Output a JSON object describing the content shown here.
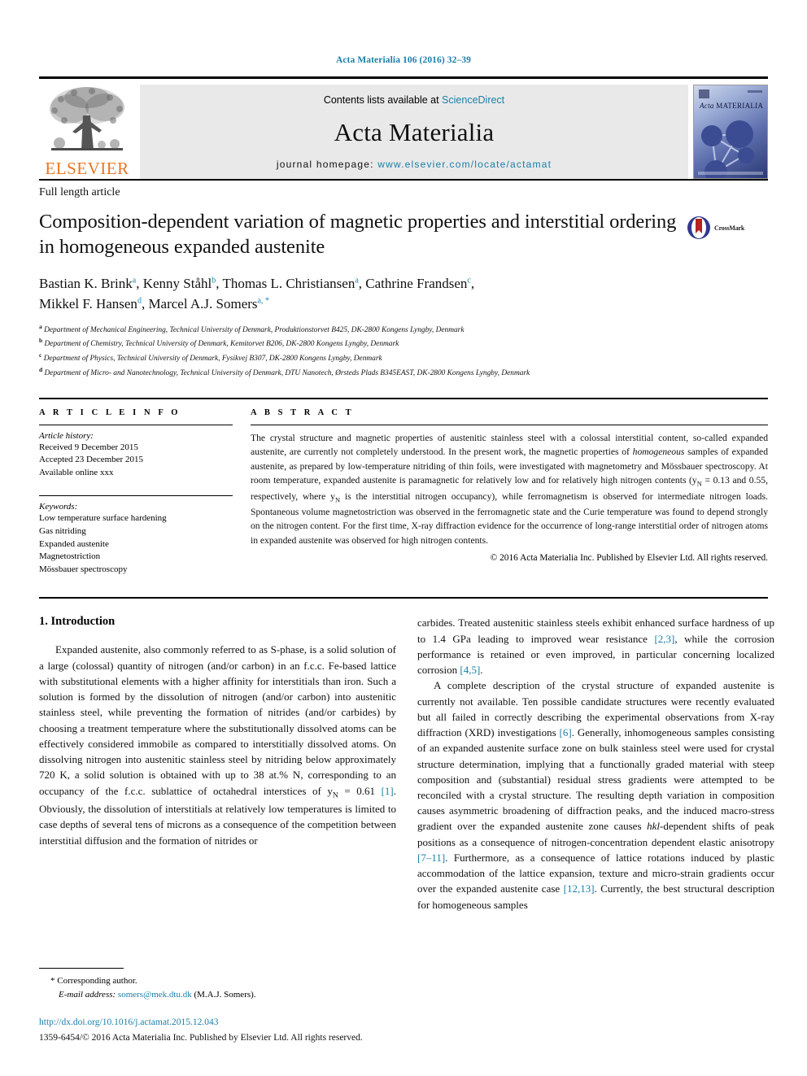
{
  "running_head": "Acta Materialia 106 (2016) 32–39",
  "masthead": {
    "publisher_logo_text": "ELSEVIER",
    "contents_prefix": "Contents lists available at ",
    "contents_link": "ScienceDirect",
    "journal_name": "Acta Materialia",
    "homepage_prefix": "journal homepage: ",
    "homepage_url": "www.elsevier.com/locate/actamat",
    "cover_title_italic": "Acta",
    "cover_title_rest": "MATERIALIA"
  },
  "article": {
    "type": "Full length article",
    "title": "Composition-dependent variation of magnetic properties and interstitial ordering in homogeneous expanded austenite",
    "crossmark_label": "CrossMark"
  },
  "authors": [
    {
      "name": "Bastian K. Brink",
      "sup": "a"
    },
    {
      "name": "Kenny Ståhl",
      "sup": "b"
    },
    {
      "name": "Thomas L. Christiansen",
      "sup": "a"
    },
    {
      "name": "Cathrine Frandsen",
      "sup": "c"
    },
    {
      "name": "Mikkel F. Hansen",
      "sup": "d"
    },
    {
      "name": "Marcel A.J. Somers",
      "sup": "a, *"
    }
  ],
  "affiliations": [
    {
      "mark": "a",
      "text": "Department of Mechanical Engineering, Technical University of Denmark, Produktionstorvet B425, DK-2800 Kongens Lyngby, Denmark"
    },
    {
      "mark": "b",
      "text": "Department of Chemistry, Technical University of Denmark, Kemitorvet B206, DK-2800 Kongens Lyngby, Denmark"
    },
    {
      "mark": "c",
      "text": "Department of Physics, Technical University of Denmark, Fysikvej B307, DK-2800 Kongens Lyngby, Denmark"
    },
    {
      "mark": "d",
      "text": "Department of Micro- and Nanotechnology, Technical University of Denmark, DTU Nanotech, Ørsteds Plads B345EAST, DK-2800 Kongens Lyngby, Denmark"
    }
  ],
  "article_info": {
    "heading": "A R T I C L E   I N F O",
    "history_label": "Article history:",
    "history": [
      "Received 9 December 2015",
      "Accepted 23 December 2015",
      "Available online xxx"
    ],
    "keywords_label": "Keywords:",
    "keywords": [
      "Low temperature surface hardening",
      "Gas nitriding",
      "Expanded austenite",
      "Magnetostriction",
      "Mössbauer spectroscopy"
    ]
  },
  "abstract": {
    "heading": "A B S T R A C T",
    "paragraph_1": "The crystal structure and magnetic properties of austenitic stainless steel with a colossal interstitial content, so-called expanded austenite, are currently not completely understood. In the present work, the magnetic properties of ",
    "emphasis_1": "homogeneous",
    "paragraph_2": " samples of expanded austenite, as prepared by low-temperature nitriding of thin foils, were investigated with magnetometry and Mössbauer spectroscopy. At room temperature, expanded austenite is paramagnetic for relatively low and for relatively high nitrogen contents (y",
    "sub_1": "N",
    "paragraph_3": " = 0.13 and 0.55, respectively, where y",
    "sub_2": "N",
    "paragraph_4": " is the interstitial nitrogen occupancy), while ferromagnetism is observed for intermediate nitrogen loads. Spontaneous volume magnetostriction was observed in the ferromagnetic state and the Curie temperature was found to depend strongly on the nitrogen content. For the first time, X-ray diffraction evidence for the occurrence of long-range interstitial order of nitrogen atoms in expanded austenite was observed for high nitrogen contents.",
    "copyright": "© 2016 Acta Materialia Inc. Published by Elsevier Ltd. All rights reserved."
  },
  "introduction": {
    "heading": "1. Introduction",
    "left_p1_a": "Expanded austenite, also commonly referred to as S-phase, is a solid solution of a large (colossal) quantity of nitrogen (and/or carbon) in an f.c.c. Fe-based lattice with substitutional elements with a higher affinity for interstitials than iron. Such a solution is formed by the dissolution of nitrogen (and/or carbon) into austenitic stainless steel, while preventing the formation of nitrides (and/or carbides) by choosing a treatment temperature where the substitutionally dissolved atoms can be effectively considered immobile as compared to interstitially dissolved atoms. On dissolving nitrogen into austenitic stainless steel by nitriding below approximately 720 K, a solid solution is obtained with up to 38 at.% N, corresponding to an occupancy of the f.c.c. sublattice of octahedral interstices of y",
    "left_sub": "N",
    "left_p1_b": " = 0.61 ",
    "left_ref1": "[1]",
    "left_p1_c": ". Obviously, the dissolution of interstitials at relatively low temperatures is limited to case depths of several tens of microns as a consequence of the competition between interstitial diffusion and the formation of nitrides or",
    "right_p1_a": "carbides. Treated austenitic stainless steels exhibit enhanced surface hardness of up to 1.4 GPa leading to improved wear resistance ",
    "right_ref1": "[2,3]",
    "right_p1_b": ", while the corrosion performance is retained or even improved, in particular concerning localized corrosion ",
    "right_ref2": "[4,5]",
    "right_p1_c": ".",
    "right_p2_a": "A complete description of the crystal structure of expanded austenite is currently not available. Ten possible candidate structures were recently evaluated but all failed in correctly describing the experimental observations from X-ray diffraction (XRD) investigations ",
    "right_ref3": "[6]",
    "right_p2_b": ". Generally, inhomogeneous samples consisting of an expanded austenite surface zone on bulk stainless steel were used for crystal structure determination, implying that a functionally graded material with steep composition and (substantial) residual stress gradients were attempted to be reconciled with a crystal structure. The resulting depth variation in composition causes asymmetric broadening of diffraction peaks, and the induced macro-stress gradient over the expanded austenite zone causes ",
    "right_em1": "hkl",
    "right_p2_c": "-dependent shifts of peak positions as a consequence of nitrogen-concentration dependent elastic anisotropy ",
    "right_ref4": "[7–11]",
    "right_p2_d": ". Furthermore, as a consequence of lattice rotations induced by plastic accommodation of the lattice expansion, texture and micro-strain gradients occur over the expanded austenite case ",
    "right_ref5": "[12,13]",
    "right_p2_e": ". Currently, the best structural description for homogeneous samples"
  },
  "footnote": {
    "star": "*",
    "corresponding": "Corresponding author.",
    "email_label": "E-mail address:",
    "email": "somers@mek.dtu.dk",
    "email_suffix": "(M.A.J. Somers)."
  },
  "footer": {
    "doi": "http://dx.doi.org/10.1016/j.actamat.2015.12.043",
    "issn_line": "1359-6454/© 2016 Acta Materialia Inc. Published by Elsevier Ltd. All rights reserved."
  },
  "colors": {
    "link": "#1a7fa8",
    "elsevier_orange": "#E87722",
    "band_gray": "#e9e9e9"
  }
}
